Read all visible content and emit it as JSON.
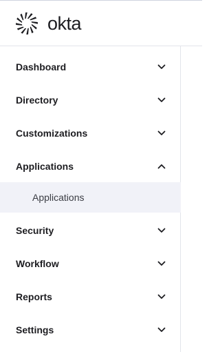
{
  "brand": {
    "logo_text": "okta",
    "logo_icon": "okta-sunburst-icon",
    "color": "#1d1d21"
  },
  "sidebar": {
    "items": [
      {
        "label": "Dashboard",
        "expanded": false,
        "icon": "chevron-down-icon"
      },
      {
        "label": "Directory",
        "expanded": false,
        "icon": "chevron-down-icon"
      },
      {
        "label": "Customizations",
        "expanded": false,
        "icon": "chevron-down-icon"
      },
      {
        "label": "Applications",
        "expanded": true,
        "icon": "chevron-up-icon",
        "children": [
          {
            "label": "Applications",
            "selected": true
          }
        ]
      },
      {
        "label": "Security",
        "expanded": false,
        "icon": "chevron-down-icon"
      },
      {
        "label": "Workflow",
        "expanded": false,
        "icon": "chevron-down-icon"
      },
      {
        "label": "Reports",
        "expanded": false,
        "icon": "chevron-down-icon"
      },
      {
        "label": "Settings",
        "expanded": false,
        "icon": "chevron-down-icon"
      }
    ]
  },
  "colors": {
    "text": "#1d1d21",
    "selected_bg": "#f1f2f8",
    "divider": "#e2e4ea"
  }
}
